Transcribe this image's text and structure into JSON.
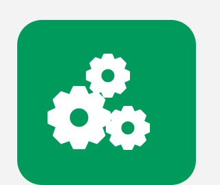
{
  "app_icon": {
    "icon": "gears-icon",
    "colors": {
      "background": "#f3f3f3",
      "tile": "#009a5c",
      "glyph": "#ffffff"
    }
  }
}
